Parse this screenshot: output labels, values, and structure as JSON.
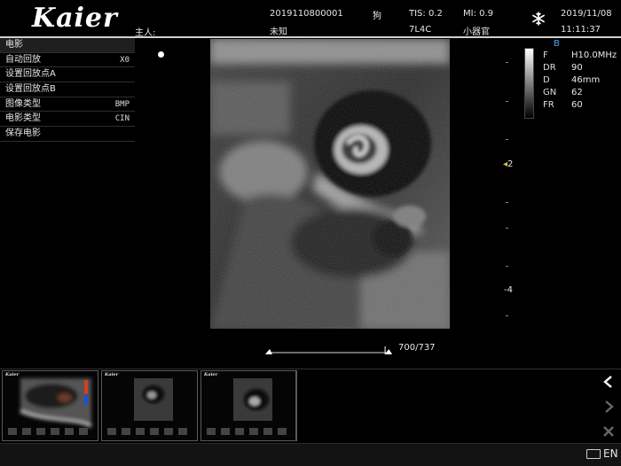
{
  "header": {
    "logo": "Kaier",
    "host_label": "主人:",
    "patient_id": "2019110800001",
    "species": "狗",
    "tis": "TIS: 0.2",
    "mi": "MI: 0.9",
    "date": "2019/11/08",
    "owner": "未知",
    "probe": "7L4C",
    "preset": "小器官",
    "time": "11:11:37",
    "freeze_icon": "snowflake-icon"
  },
  "menu": {
    "title": "电影",
    "items": [
      {
        "label": "自动回放",
        "value": "X0"
      },
      {
        "label": "设置回放点A",
        "value": ""
      },
      {
        "label": "设置回放点B",
        "value": ""
      },
      {
        "label": "图像类型",
        "value": "BMP"
      },
      {
        "label": "电影类型",
        "value": "CIN"
      },
      {
        "label": "保存电影",
        "value": ""
      }
    ]
  },
  "params": {
    "mode": "B",
    "rows": [
      {
        "k": "F",
        "v": "H10.0MHz"
      },
      {
        "k": "DR",
        "v": "90"
      },
      {
        "k": "D",
        "v": "46mm"
      },
      {
        "k": "GN",
        "v": "62"
      },
      {
        "k": "FR",
        "v": "60"
      }
    ]
  },
  "depth_labels": [
    "2",
    "4"
  ],
  "cine": {
    "position": "700/737",
    "fraction": 0.95
  },
  "thumbnails": [
    {
      "logo": "Kaier"
    },
    {
      "logo": "Kaier"
    },
    {
      "logo": "Kaier"
    }
  ],
  "nav": {
    "prev_icon": "chevron-left-icon",
    "next_icon": "chevron-right-icon",
    "delete_icon": "close-icon"
  },
  "status": {
    "language": "EN"
  }
}
